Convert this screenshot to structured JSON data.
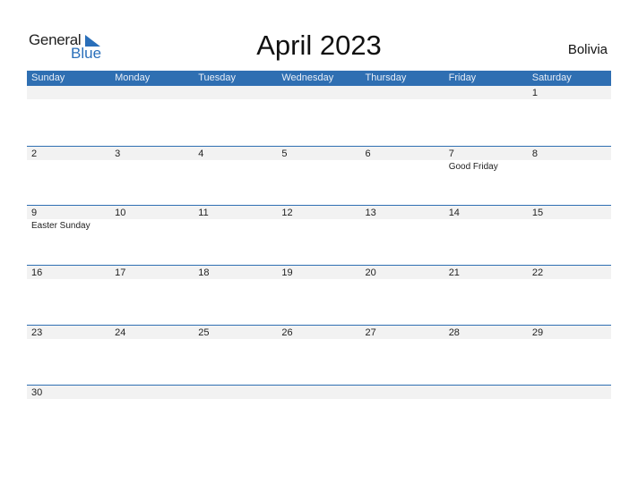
{
  "logo": {
    "general": "General",
    "blue": "Blue"
  },
  "title": "April 2023",
  "country": "Bolivia",
  "colors": {
    "accent": "#2f6fb2",
    "strip": "#f2f2f2"
  },
  "weekdays": [
    "Sunday",
    "Monday",
    "Tuesday",
    "Wednesday",
    "Thursday",
    "Friday",
    "Saturday"
  ],
  "weeks": [
    [
      {
        "day": ""
      },
      {
        "day": ""
      },
      {
        "day": ""
      },
      {
        "day": ""
      },
      {
        "day": ""
      },
      {
        "day": ""
      },
      {
        "day": "1"
      }
    ],
    [
      {
        "day": "2"
      },
      {
        "day": "3"
      },
      {
        "day": "4"
      },
      {
        "day": "5"
      },
      {
        "day": "6"
      },
      {
        "day": "7",
        "event": "Good Friday"
      },
      {
        "day": "8"
      }
    ],
    [
      {
        "day": "9",
        "event": "Easter Sunday"
      },
      {
        "day": "10"
      },
      {
        "day": "11"
      },
      {
        "day": "12"
      },
      {
        "day": "13"
      },
      {
        "day": "14"
      },
      {
        "day": "15"
      }
    ],
    [
      {
        "day": "16"
      },
      {
        "day": "17"
      },
      {
        "day": "18"
      },
      {
        "day": "19"
      },
      {
        "day": "20"
      },
      {
        "day": "21"
      },
      {
        "day": "22"
      }
    ],
    [
      {
        "day": "23"
      },
      {
        "day": "24"
      },
      {
        "day": "25"
      },
      {
        "day": "26"
      },
      {
        "day": "27"
      },
      {
        "day": "28"
      },
      {
        "day": "29"
      }
    ],
    [
      {
        "day": "30"
      },
      {
        "day": ""
      },
      {
        "day": ""
      },
      {
        "day": ""
      },
      {
        "day": ""
      },
      {
        "day": ""
      },
      {
        "day": ""
      }
    ]
  ]
}
